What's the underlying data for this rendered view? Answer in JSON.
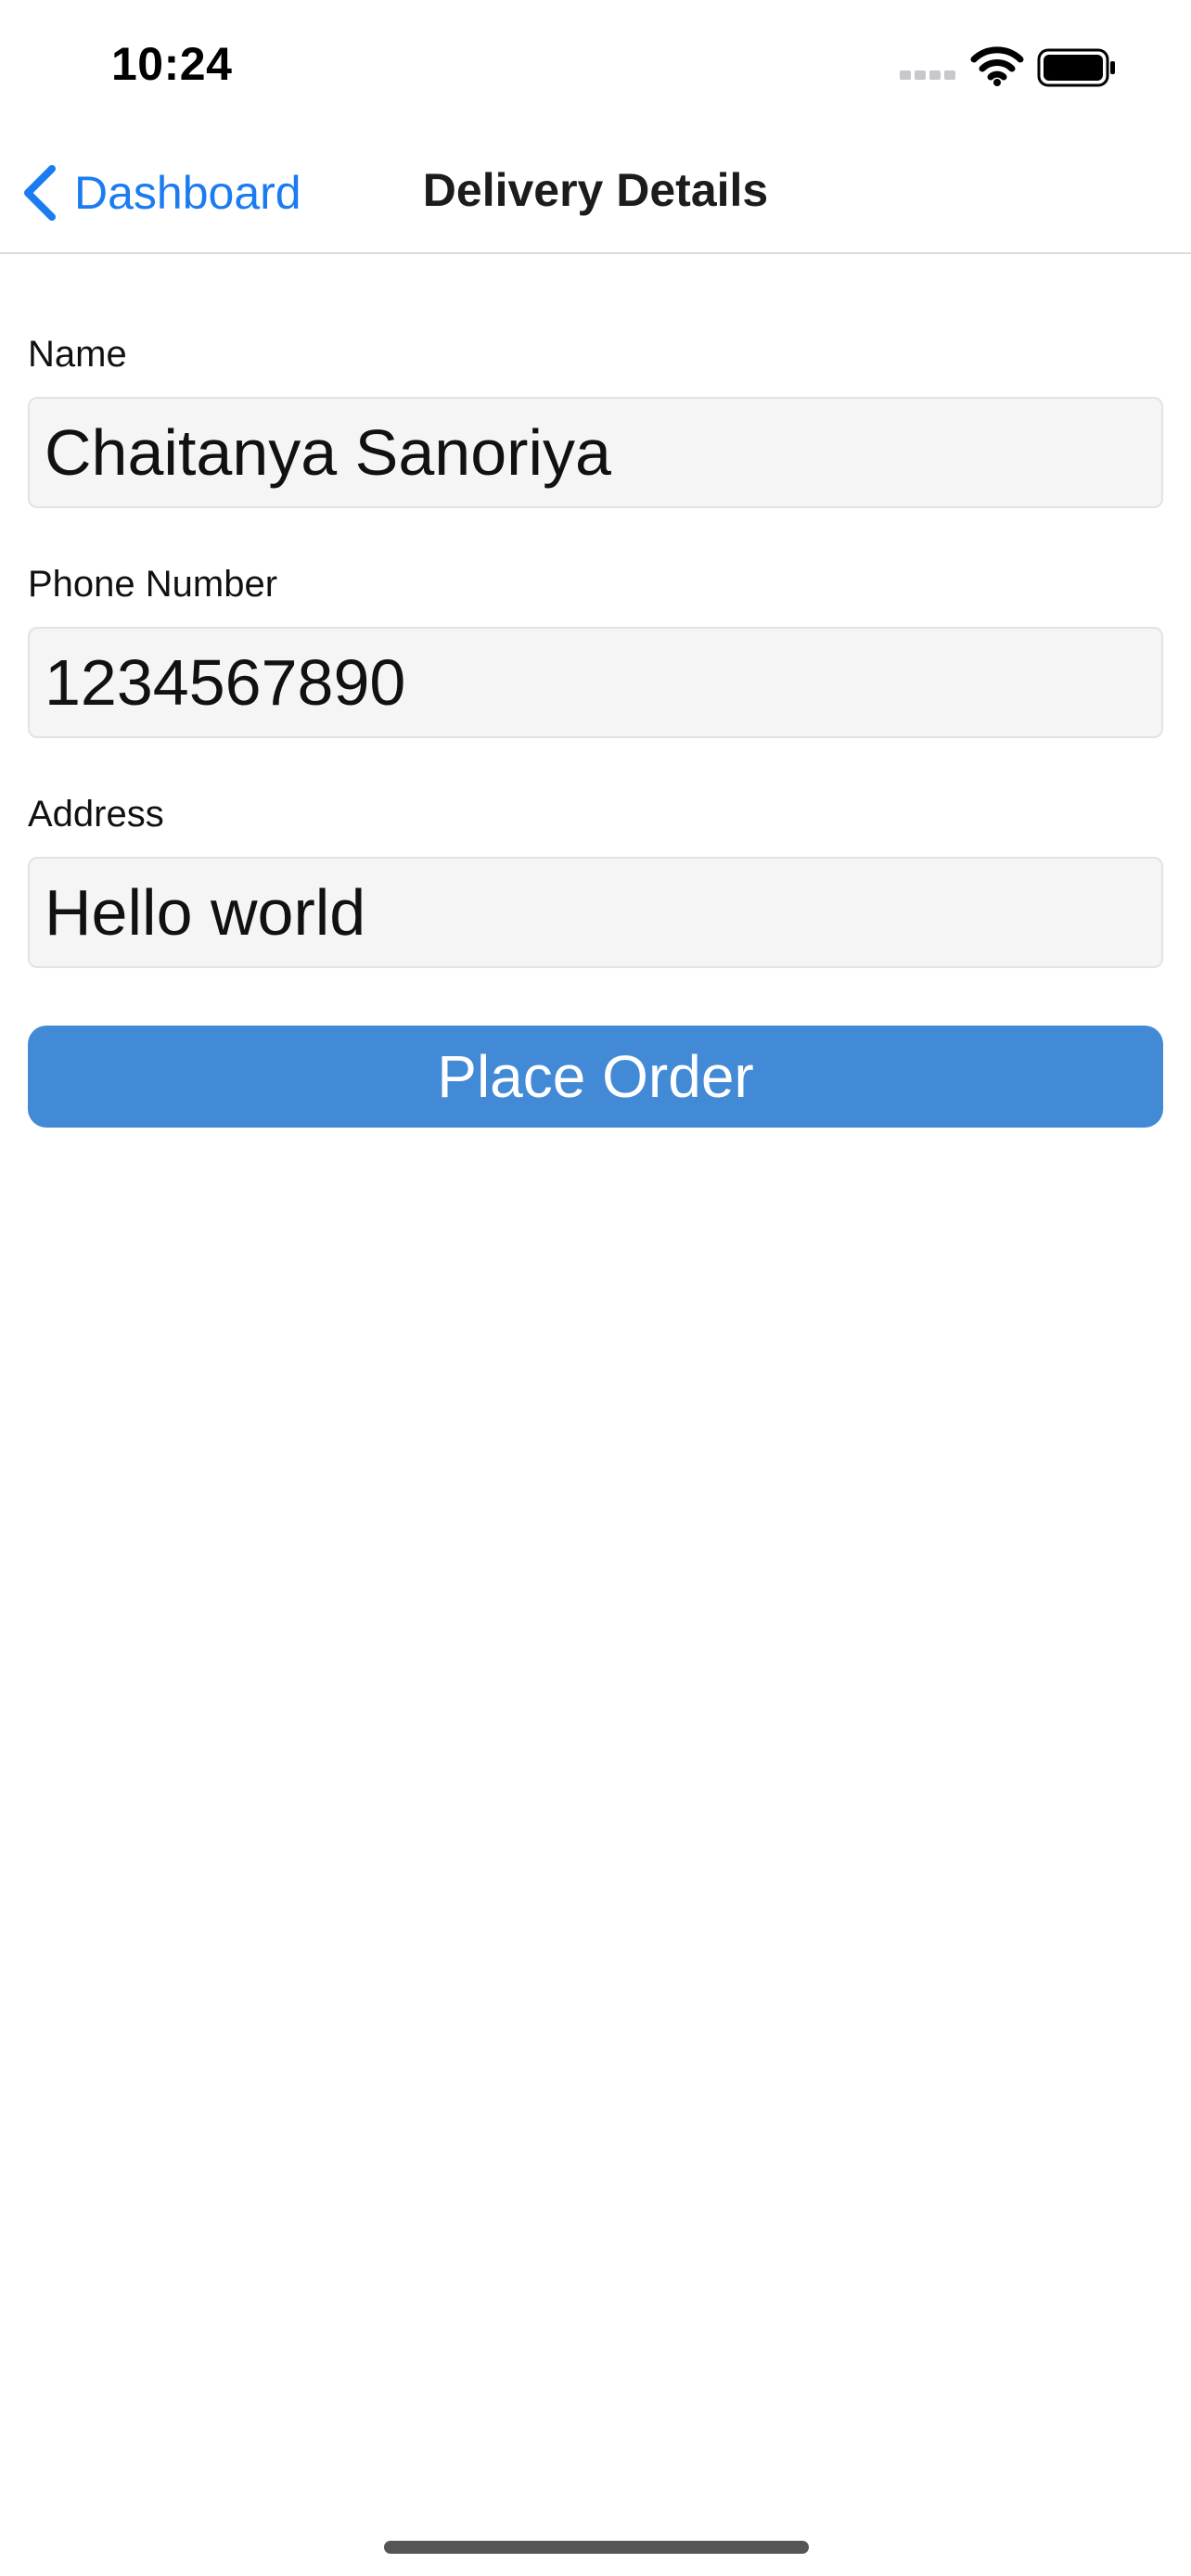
{
  "status_bar": {
    "time": "10:24",
    "signal_icon": "cellular-signal-icon",
    "wifi_icon": "wifi-icon",
    "battery_icon": "battery-icon"
  },
  "nav": {
    "back_icon": "chevron-left-icon",
    "back_label": "Dashboard",
    "title": "Delivery Details"
  },
  "form": {
    "name": {
      "label": "Name",
      "value": "Chaitanya Sanoriya"
    },
    "phone": {
      "label": "Phone Number",
      "value": "1234567890"
    },
    "address": {
      "label": "Address",
      "value": "Hello world"
    },
    "submit_label": "Place Order"
  },
  "colors": {
    "accent": "#1a7cf0",
    "button": "#428ad6",
    "field_background": "#f5f5f5"
  }
}
